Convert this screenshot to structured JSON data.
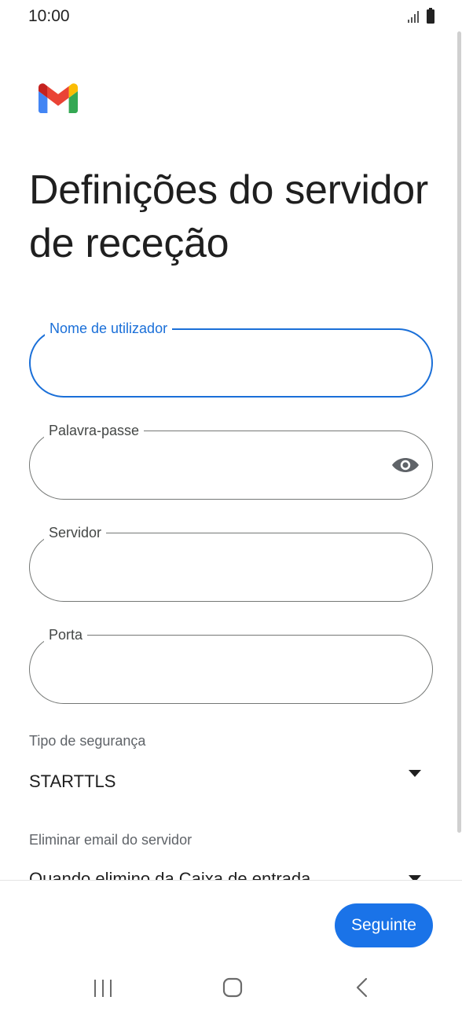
{
  "status_bar": {
    "time": "10:00"
  },
  "page": {
    "title": "Definições do servidor de receção"
  },
  "fields": {
    "username": {
      "label": "Nome de utilizador",
      "value": ""
    },
    "password": {
      "label": "Palavra-passe",
      "value": ""
    },
    "server": {
      "label": "Servidor",
      "value": ""
    },
    "port": {
      "label": "Porta",
      "value": ""
    }
  },
  "security": {
    "label": "Tipo de segurança",
    "selected": "STARTTLS"
  },
  "delete_email": {
    "label": "Eliminar email do servidor",
    "selected": "Quando elimino da Caixa de entrada"
  },
  "actions": {
    "next_label": "Seguinte"
  },
  "icons": {
    "logo": "gmail-logo",
    "password_toggle": "eye-icon",
    "dropdown": "dropdown-arrow-icon",
    "nav_recent": "recent-apps-icon",
    "nav_home": "home-icon",
    "nav_back": "back-icon"
  },
  "colors": {
    "accent": "#1a73e8",
    "focus_border": "#1a6fd8",
    "outline": "#747775"
  }
}
